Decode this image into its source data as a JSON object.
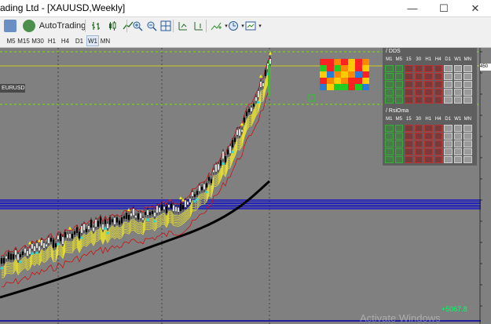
{
  "window": {
    "title": "ading Ltd - [XAUUSD,Weekly]",
    "minimize": "—",
    "maximize": "☐",
    "close": "✕"
  },
  "toolbar": {
    "autotrading_label": "AutoTrading"
  },
  "timeframes": [
    "M5",
    "M15",
    "M30",
    "H1",
    "H4",
    "D1",
    "W1",
    "MN"
  ],
  "selected_timeframe": "W1",
  "chart": {
    "symbol_label": "EURUSD",
    "price_labels": [
      "450",
      "",
      "",
      "",
      "",
      "",
      "",
      "",
      "",
      "",
      "",
      ""
    ],
    "bottom_value": "+5067.8",
    "overlay_text": "Activate Windows"
  },
  "dds_panel": {
    "title": "/ DDS",
    "headers": [
      "M1",
      "M5",
      "15",
      "30",
      "H1",
      "H4",
      "D1",
      "W1",
      "MN"
    ]
  },
  "rsioma_panel": {
    "title": "/ RsiOma",
    "headers": [
      "M1",
      "M5",
      "15",
      "30",
      "H1",
      "H4",
      "D1",
      "W1",
      "MN"
    ]
  },
  "colors": {
    "bull": "#ffffff",
    "bear": "#000000",
    "band_blue": "#0000cc",
    "grid_green": "#7cfc00",
    "ma_black": "#000000",
    "ma_red": "#cc0000"
  }
}
